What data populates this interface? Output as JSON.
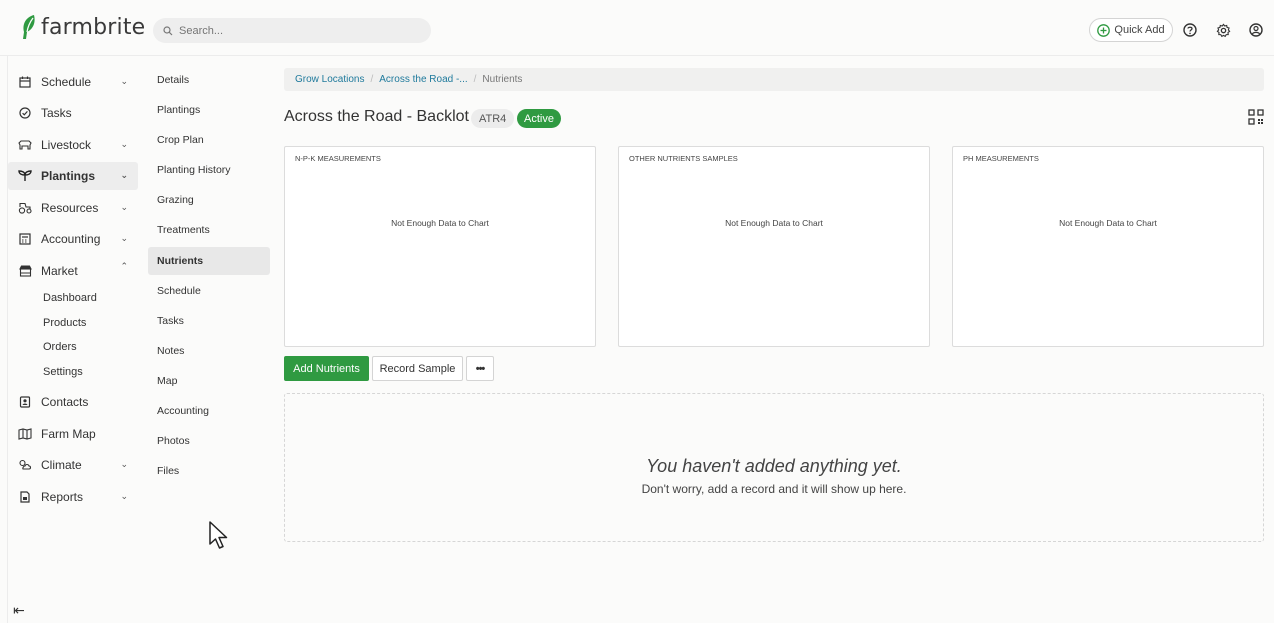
{
  "app": {
    "brand_name": "farmbrite",
    "brand_color": "#2f9a41"
  },
  "header": {
    "search_placeholder": "Search...",
    "quick_add_label": "Quick Add",
    "icons": [
      "help-icon",
      "settings-icon",
      "account-icon"
    ]
  },
  "sidebar": {
    "items": [
      {
        "label": "Schedule",
        "icon": "calendar-icon",
        "expandable": true
      },
      {
        "label": "Tasks",
        "icon": "check-circle-icon",
        "expandable": false
      },
      {
        "label": "Livestock",
        "icon": "cow-icon",
        "expandable": true
      },
      {
        "label": "Plantings",
        "icon": "sprout-icon",
        "expandable": true,
        "active": true
      },
      {
        "label": "Resources",
        "icon": "tractor-icon",
        "expandable": true
      },
      {
        "label": "Accounting",
        "icon": "calculator-icon",
        "expandable": true
      },
      {
        "label": "Market",
        "icon": "store-icon",
        "expandable": true,
        "expanded": true
      },
      {
        "label": "Contacts",
        "icon": "contact-icon",
        "expandable": false
      },
      {
        "label": "Farm Map",
        "icon": "map-icon",
        "expandable": false
      },
      {
        "label": "Climate",
        "icon": "weather-icon",
        "expandable": true
      },
      {
        "label": "Reports",
        "icon": "report-icon",
        "expandable": true
      }
    ],
    "market_sub": [
      "Dashboard",
      "Products",
      "Orders",
      "Settings"
    ]
  },
  "subnav": {
    "items": [
      "Details",
      "Plantings",
      "Crop Plan",
      "Planting History",
      "Grazing",
      "Treatments",
      "Nutrients",
      "Schedule",
      "Tasks",
      "Notes",
      "Map",
      "Accounting",
      "Photos",
      "Files"
    ],
    "active": "Nutrients"
  },
  "breadcrumb": {
    "items": [
      "Grow Locations",
      "Across the Road -...",
      "Nutrients"
    ]
  },
  "page": {
    "title": "Across the Road - Backlot",
    "code_badge": "ATR4",
    "status_badge": "Active"
  },
  "charts": [
    {
      "title": "N-P-K MEASUREMENTS",
      "message": "Not Enough Data to Chart"
    },
    {
      "title": "OTHER NUTRIENTS SAMPLES",
      "message": "Not Enough Data to Chart"
    },
    {
      "title": "PH MEASUREMENTS",
      "message": "Not Enough Data to Chart"
    }
  ],
  "actions": {
    "add_label": "Add Nutrients",
    "record_label": "Record Sample",
    "more_label": "•••"
  },
  "empty_state": {
    "heading": "You haven't added anything yet.",
    "text": "Don't worry, add a record and it will show up here."
  }
}
